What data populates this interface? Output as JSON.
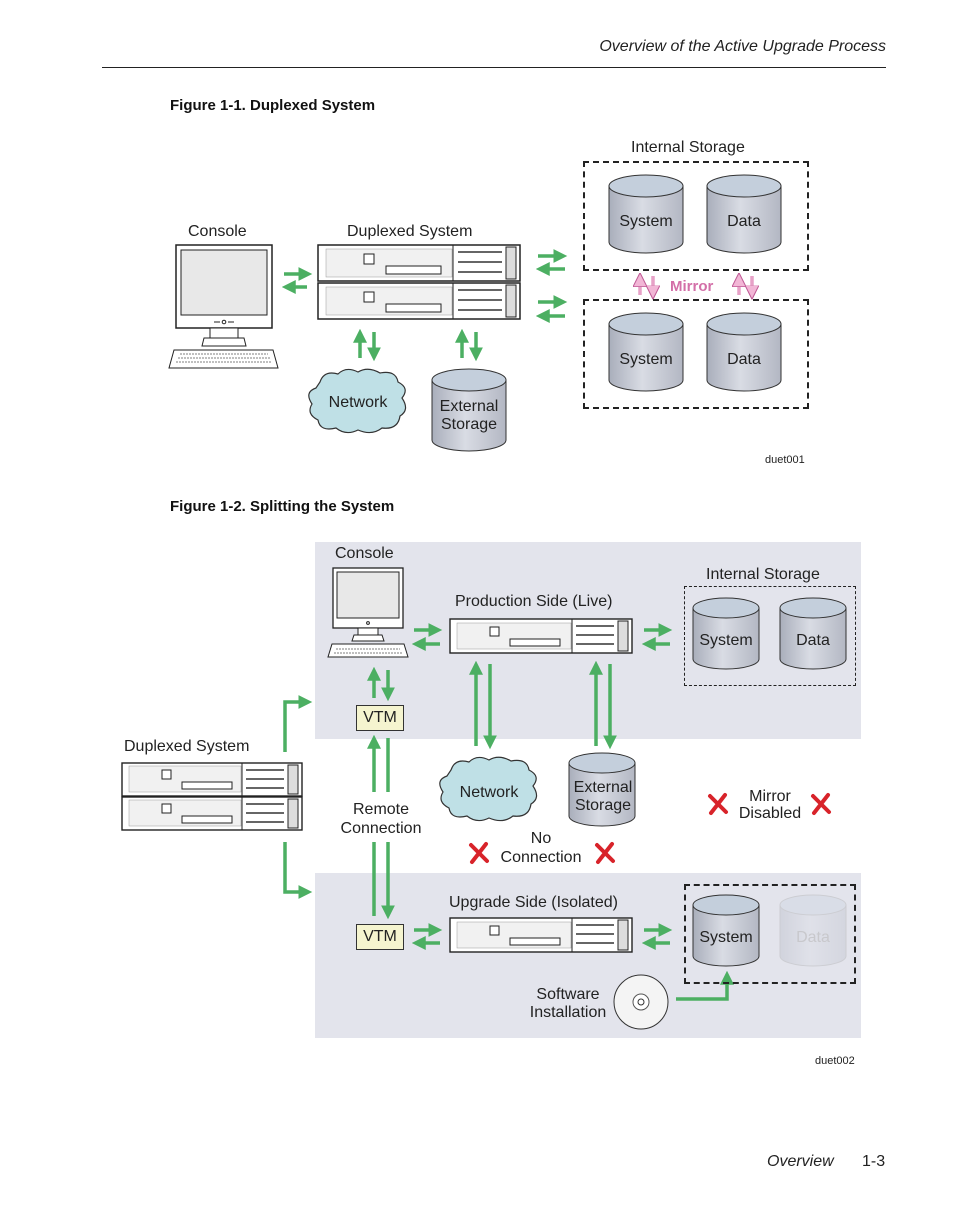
{
  "page": {
    "running_header": "Overview of the Active Upgrade Process",
    "footer_section": "Overview",
    "footer_page": "1-3"
  },
  "figure1": {
    "caption": "Figure 1-1. Duplexed System",
    "labels": {
      "console": "Console",
      "duplexed_system": "Duplexed System",
      "internal_storage": "Internal Storage",
      "system_disk_top": "System",
      "data_disk_top": "Data",
      "system_disk_bottom": "System",
      "data_disk_bottom": "Data",
      "mirror": "Mirror",
      "network": "Network",
      "external_storage_line1": "External",
      "external_storage_line2": "Storage",
      "figure_id": "duet001"
    }
  },
  "figure2": {
    "caption": "Figure 1-2. Splitting the System",
    "labels": {
      "console": "Console",
      "production_side": "Production Side (Live)",
      "internal_storage": "Internal Storage",
      "system_disk_prod": "System",
      "data_disk_prod": "Data",
      "vtm_top": "VTM",
      "duplexed_system": "Duplexed System",
      "remote_connection_line1": "Remote",
      "remote_connection_line2": "Connection",
      "network": "Network",
      "external_storage_line1": "External",
      "external_storage_line2": "Storage",
      "mirror_disabled_line1": "Mirror",
      "mirror_disabled_line2": "Disabled",
      "no_connection_line1": "No",
      "no_connection_line2": "Connection",
      "upgrade_side": "Upgrade Side (Isolated)",
      "vtm_bottom": "VTM",
      "system_disk_upg": "System",
      "data_disk_upg": "Data",
      "software_installation_line1": "Software",
      "software_installation_line2": "Installation",
      "figure_id": "duet002"
    }
  },
  "colors": {
    "arrow_green": "#4caf62",
    "mirror_pink": "#d36fa8",
    "x_red": "#d8232a",
    "panel_bg": "#e3e4ec",
    "cloud_fill": "#bfe0e6",
    "disk_fill": "#c4c8d4",
    "vtm_fill": "#f5f4cf"
  }
}
